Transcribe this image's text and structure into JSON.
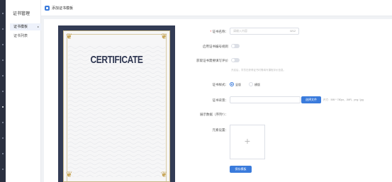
{
  "sidebar": {
    "title": "证书管理",
    "items": [
      {
        "label": "证书模板",
        "caret": "▸"
      },
      {
        "label": "证书列表"
      }
    ]
  },
  "topbar": {
    "title": "添加证书模板"
  },
  "certificate": {
    "title": "CERTIFICATE"
  },
  "form": {
    "cert_name_label": "证书名称：",
    "cert_name_placeholder": "请输入内容",
    "cert_name_count": "0/12",
    "enable_number_label": "启用证书编号规则",
    "enable_evaluation_label": "获取证书需要填写评价",
    "evaluation_hint": "开启后，学员在获得证书时需填写课程评价信息。",
    "style_label": "证书样式：",
    "style_option_1": "竖版",
    "style_option_2": "横版",
    "bg_label": "证书背景：",
    "upload_button": "选择文件",
    "bg_hint": "尺寸：595 * 780px，JMR，png / jpg",
    "show_data_label": "展示数据（序列*）：",
    "element_label": "元素设置：",
    "save_button": "保存模板"
  }
}
